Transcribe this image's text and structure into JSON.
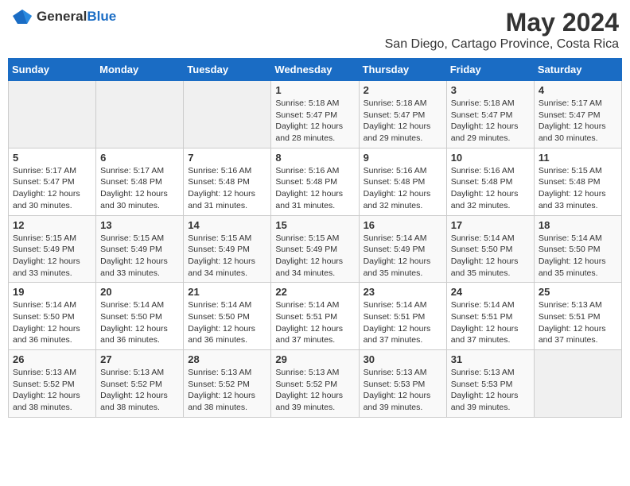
{
  "logo": {
    "general": "General",
    "blue": "Blue"
  },
  "title": "May 2024",
  "subtitle": "San Diego, Cartago Province, Costa Rica",
  "days_header": [
    "Sunday",
    "Monday",
    "Tuesday",
    "Wednesday",
    "Thursday",
    "Friday",
    "Saturday"
  ],
  "weeks": [
    [
      {
        "day": "",
        "sunrise": "",
        "sunset": "",
        "daylight": ""
      },
      {
        "day": "",
        "sunrise": "",
        "sunset": "",
        "daylight": ""
      },
      {
        "day": "",
        "sunrise": "",
        "sunset": "",
        "daylight": ""
      },
      {
        "day": "1",
        "sunrise": "Sunrise: 5:18 AM",
        "sunset": "Sunset: 5:47 PM",
        "daylight": "Daylight: 12 hours and 28 minutes."
      },
      {
        "day": "2",
        "sunrise": "Sunrise: 5:18 AM",
        "sunset": "Sunset: 5:47 PM",
        "daylight": "Daylight: 12 hours and 29 minutes."
      },
      {
        "day": "3",
        "sunrise": "Sunrise: 5:18 AM",
        "sunset": "Sunset: 5:47 PM",
        "daylight": "Daylight: 12 hours and 29 minutes."
      },
      {
        "day": "4",
        "sunrise": "Sunrise: 5:17 AM",
        "sunset": "Sunset: 5:47 PM",
        "daylight": "Daylight: 12 hours and 30 minutes."
      }
    ],
    [
      {
        "day": "5",
        "sunrise": "Sunrise: 5:17 AM",
        "sunset": "Sunset: 5:47 PM",
        "daylight": "Daylight: 12 hours and 30 minutes."
      },
      {
        "day": "6",
        "sunrise": "Sunrise: 5:17 AM",
        "sunset": "Sunset: 5:48 PM",
        "daylight": "Daylight: 12 hours and 30 minutes."
      },
      {
        "day": "7",
        "sunrise": "Sunrise: 5:16 AM",
        "sunset": "Sunset: 5:48 PM",
        "daylight": "Daylight: 12 hours and 31 minutes."
      },
      {
        "day": "8",
        "sunrise": "Sunrise: 5:16 AM",
        "sunset": "Sunset: 5:48 PM",
        "daylight": "Daylight: 12 hours and 31 minutes."
      },
      {
        "day": "9",
        "sunrise": "Sunrise: 5:16 AM",
        "sunset": "Sunset: 5:48 PM",
        "daylight": "Daylight: 12 hours and 32 minutes."
      },
      {
        "day": "10",
        "sunrise": "Sunrise: 5:16 AM",
        "sunset": "Sunset: 5:48 PM",
        "daylight": "Daylight: 12 hours and 32 minutes."
      },
      {
        "day": "11",
        "sunrise": "Sunrise: 5:15 AM",
        "sunset": "Sunset: 5:48 PM",
        "daylight": "Daylight: 12 hours and 33 minutes."
      }
    ],
    [
      {
        "day": "12",
        "sunrise": "Sunrise: 5:15 AM",
        "sunset": "Sunset: 5:49 PM",
        "daylight": "Daylight: 12 hours and 33 minutes."
      },
      {
        "day": "13",
        "sunrise": "Sunrise: 5:15 AM",
        "sunset": "Sunset: 5:49 PM",
        "daylight": "Daylight: 12 hours and 33 minutes."
      },
      {
        "day": "14",
        "sunrise": "Sunrise: 5:15 AM",
        "sunset": "Sunset: 5:49 PM",
        "daylight": "Daylight: 12 hours and 34 minutes."
      },
      {
        "day": "15",
        "sunrise": "Sunrise: 5:15 AM",
        "sunset": "Sunset: 5:49 PM",
        "daylight": "Daylight: 12 hours and 34 minutes."
      },
      {
        "day": "16",
        "sunrise": "Sunrise: 5:14 AM",
        "sunset": "Sunset: 5:49 PM",
        "daylight": "Daylight: 12 hours and 35 minutes."
      },
      {
        "day": "17",
        "sunrise": "Sunrise: 5:14 AM",
        "sunset": "Sunset: 5:50 PM",
        "daylight": "Daylight: 12 hours and 35 minutes."
      },
      {
        "day": "18",
        "sunrise": "Sunrise: 5:14 AM",
        "sunset": "Sunset: 5:50 PM",
        "daylight": "Daylight: 12 hours and 35 minutes."
      }
    ],
    [
      {
        "day": "19",
        "sunrise": "Sunrise: 5:14 AM",
        "sunset": "Sunset: 5:50 PM",
        "daylight": "Daylight: 12 hours and 36 minutes."
      },
      {
        "day": "20",
        "sunrise": "Sunrise: 5:14 AM",
        "sunset": "Sunset: 5:50 PM",
        "daylight": "Daylight: 12 hours and 36 minutes."
      },
      {
        "day": "21",
        "sunrise": "Sunrise: 5:14 AM",
        "sunset": "Sunset: 5:50 PM",
        "daylight": "Daylight: 12 hours and 36 minutes."
      },
      {
        "day": "22",
        "sunrise": "Sunrise: 5:14 AM",
        "sunset": "Sunset: 5:51 PM",
        "daylight": "Daylight: 12 hours and 37 minutes."
      },
      {
        "day": "23",
        "sunrise": "Sunrise: 5:14 AM",
        "sunset": "Sunset: 5:51 PM",
        "daylight": "Daylight: 12 hours and 37 minutes."
      },
      {
        "day": "24",
        "sunrise": "Sunrise: 5:14 AM",
        "sunset": "Sunset: 5:51 PM",
        "daylight": "Daylight: 12 hours and 37 minutes."
      },
      {
        "day": "25",
        "sunrise": "Sunrise: 5:13 AM",
        "sunset": "Sunset: 5:51 PM",
        "daylight": "Daylight: 12 hours and 37 minutes."
      }
    ],
    [
      {
        "day": "26",
        "sunrise": "Sunrise: 5:13 AM",
        "sunset": "Sunset: 5:52 PM",
        "daylight": "Daylight: 12 hours and 38 minutes."
      },
      {
        "day": "27",
        "sunrise": "Sunrise: 5:13 AM",
        "sunset": "Sunset: 5:52 PM",
        "daylight": "Daylight: 12 hours and 38 minutes."
      },
      {
        "day": "28",
        "sunrise": "Sunrise: 5:13 AM",
        "sunset": "Sunset: 5:52 PM",
        "daylight": "Daylight: 12 hours and 38 minutes."
      },
      {
        "day": "29",
        "sunrise": "Sunrise: 5:13 AM",
        "sunset": "Sunset: 5:52 PM",
        "daylight": "Daylight: 12 hours and 39 minutes."
      },
      {
        "day": "30",
        "sunrise": "Sunrise: 5:13 AM",
        "sunset": "Sunset: 5:53 PM",
        "daylight": "Daylight: 12 hours and 39 minutes."
      },
      {
        "day": "31",
        "sunrise": "Sunrise: 5:13 AM",
        "sunset": "Sunset: 5:53 PM",
        "daylight": "Daylight: 12 hours and 39 minutes."
      },
      {
        "day": "",
        "sunrise": "",
        "sunset": "",
        "daylight": ""
      }
    ]
  ]
}
